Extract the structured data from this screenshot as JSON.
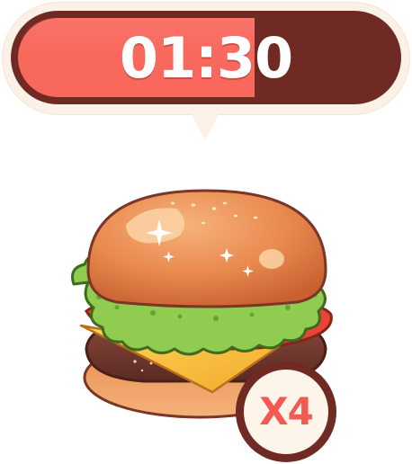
{
  "timer": {
    "time_remaining": "01:30",
    "progress": 0.63
  },
  "order": {
    "item_icon": "hamburger-icon",
    "quantity_label": "X4"
  },
  "colors": {
    "timer_fill": "#f9685d",
    "timer_track": "#6f2a24",
    "bubble_background": "#fcf1e6",
    "badge_border": "#6f2a24",
    "badge_text": "#f25a52"
  }
}
